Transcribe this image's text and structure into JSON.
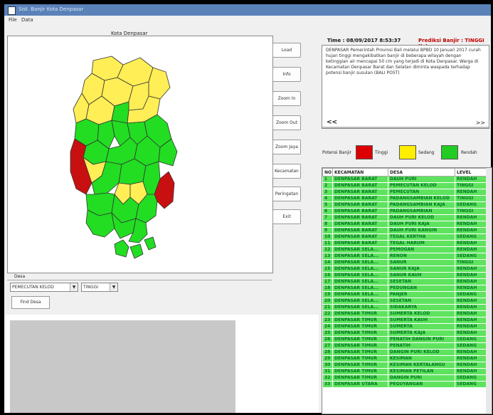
{
  "window": {
    "title": "Sist. Banjir Kota Denpasar"
  },
  "menu": [
    "File",
    "Data"
  ],
  "map": {
    "caption": "Kota Denpasar"
  },
  "buttons": [
    "Load",
    "Info",
    "Zoom In",
    "Zoom Out",
    "Zoom Jaya",
    "Kecamatan",
    "Peringatan",
    "Exit"
  ],
  "header": {
    "time_label": "Time : 08/09/2017 8:53:37",
    "potential_label": "Prediksi Banjir : TINGGI Kat"
  },
  "news": {
    "text": "DENPASAR Pemerintah Provinsi Bali melalui BPBD 10 Januari 2017 curah hujan tinggi mengakibatkan banjir di beberapa wilayah dengan ketinggian air mencapai 50 cm yang terjadi di Kota Denpasar. Warga di Kecamatan Denpasar Barat dan Selatan diminta waspada terhadap potensi banjir susulan (BALI POST)",
    "prev": "<<",
    "next": ">>"
  },
  "legend": {
    "title": "Potensi Banjir",
    "items": [
      {
        "label": "Tinggi",
        "color": "#dd0000"
      },
      {
        "label": "Sedang",
        "color": "#ffee00"
      },
      {
        "label": "Rendah",
        "color": "#22cc22"
      }
    ]
  },
  "table": {
    "columns": [
      "NO",
      "KECAMATAN",
      "DESA",
      "LEVEL"
    ],
    "rows": [
      [
        "1",
        "DENPASAR BARAT",
        "DAUH PURI",
        "RENDAH"
      ],
      [
        "2",
        "DENPASAR BARAT",
        "PEMECUTAN KELOD",
        "TINGGI"
      ],
      [
        "3",
        "DENPASAR BARAT",
        "PEMECUTAN",
        "RENDAH"
      ],
      [
        "4",
        "DENPASAR BARAT",
        "PADANGSAMBIAN KELOD",
        "TINGGI"
      ],
      [
        "5",
        "DENPASAR BARAT",
        "PADANGSAMBIAN KAJA",
        "SEDANG"
      ],
      [
        "6",
        "DENPASAR BARAT",
        "PADANGSAMBIAN",
        "TINGGI"
      ],
      [
        "7",
        "DENPASAR BARAT",
        "DAUH PURI KELOD",
        "RENDAH"
      ],
      [
        "8",
        "DENPASAR BARAT",
        "DAUH PURI KAJA",
        "RENDAH"
      ],
      [
        "9",
        "DENPASAR BARAT",
        "DAUH PURI KANGIN",
        "RENDAH"
      ],
      [
        "10",
        "DENPASAR BARAT",
        "TEGAL KERTHA",
        "SEDANG"
      ],
      [
        "11",
        "DENPASAR BARAT",
        "TEGAL HARUM",
        "RENDAH"
      ],
      [
        "12",
        "DENPASAR SELA...",
        "PEMOGAN",
        "RENDAH"
      ],
      [
        "13",
        "DENPASAR SELA...",
        "RENON",
        "SEDANG"
      ],
      [
        "14",
        "DENPASAR SELA...",
        "SANUR",
        "TINGGI"
      ],
      [
        "15",
        "DENPASAR SELA...",
        "SANUR KAJA",
        "RENDAH"
      ],
      [
        "16",
        "DENPASAR SELA...",
        "SANUR KAUH",
        "RENDAH"
      ],
      [
        "17",
        "DENPASAR SELA...",
        "SESETAN",
        "RENDAH"
      ],
      [
        "18",
        "DENPASAR SELA...",
        "PEDUNGAN",
        "RENDAH"
      ],
      [
        "19",
        "DENPASAR SELA...",
        "PANJER",
        "SEDANG"
      ],
      [
        "20",
        "DENPASAR SELA...",
        "SESETAN",
        "RENDAH"
      ],
      [
        "21",
        "DENPASAR SELA...",
        "SIDAKARYA",
        "RENDAH"
      ],
      [
        "22",
        "DENPASAR TIMUR",
        "SUMERTA KELOD",
        "RENDAH"
      ],
      [
        "23",
        "DENPASAR TIMUR",
        "SUMERTA KAUH",
        "RENDAH"
      ],
      [
        "24",
        "DENPASAR TIMUR",
        "SUMERTA",
        "RENDAH"
      ],
      [
        "25",
        "DENPASAR TIMUR",
        "SUMERTA KAJA",
        "RENDAH"
      ],
      [
        "26",
        "DENPASAR TIMUR",
        "PENATIH DANGIN PURI",
        "SEDANG"
      ],
      [
        "27",
        "DENPASAR TIMUR",
        "PENATIH",
        "SEDANG"
      ],
      [
        "28",
        "DENPASAR TIMUR",
        "DANGIN PURI KELOD",
        "RENDAH"
      ],
      [
        "29",
        "DENPASAR TIMUR",
        "KESIMAN",
        "RENDAH"
      ],
      [
        "30",
        "DENPASAR TIMUR",
        "KESIMAN KERTALANGU",
        "RENDAH"
      ],
      [
        "31",
        "DENPASAR TIMUR",
        "KESIMAN PETILAN",
        "RENDAH"
      ],
      [
        "32",
        "DENPASAR TIMUR",
        "DANGIN PURI",
        "SEDANG"
      ],
      [
        "33",
        "DENPASAR UTARA",
        "PEGUYANGAN",
        "SEDANG"
      ]
    ]
  },
  "desa": {
    "title": "Desa",
    "select1": "PEMECUTAN KELOD",
    "select2": "TINGGI",
    "find_button": "Find Desa"
  },
  "colors": {
    "high": "#c81010",
    "medium": "#ffee55",
    "low": "#22dd22",
    "border": "#333333"
  }
}
